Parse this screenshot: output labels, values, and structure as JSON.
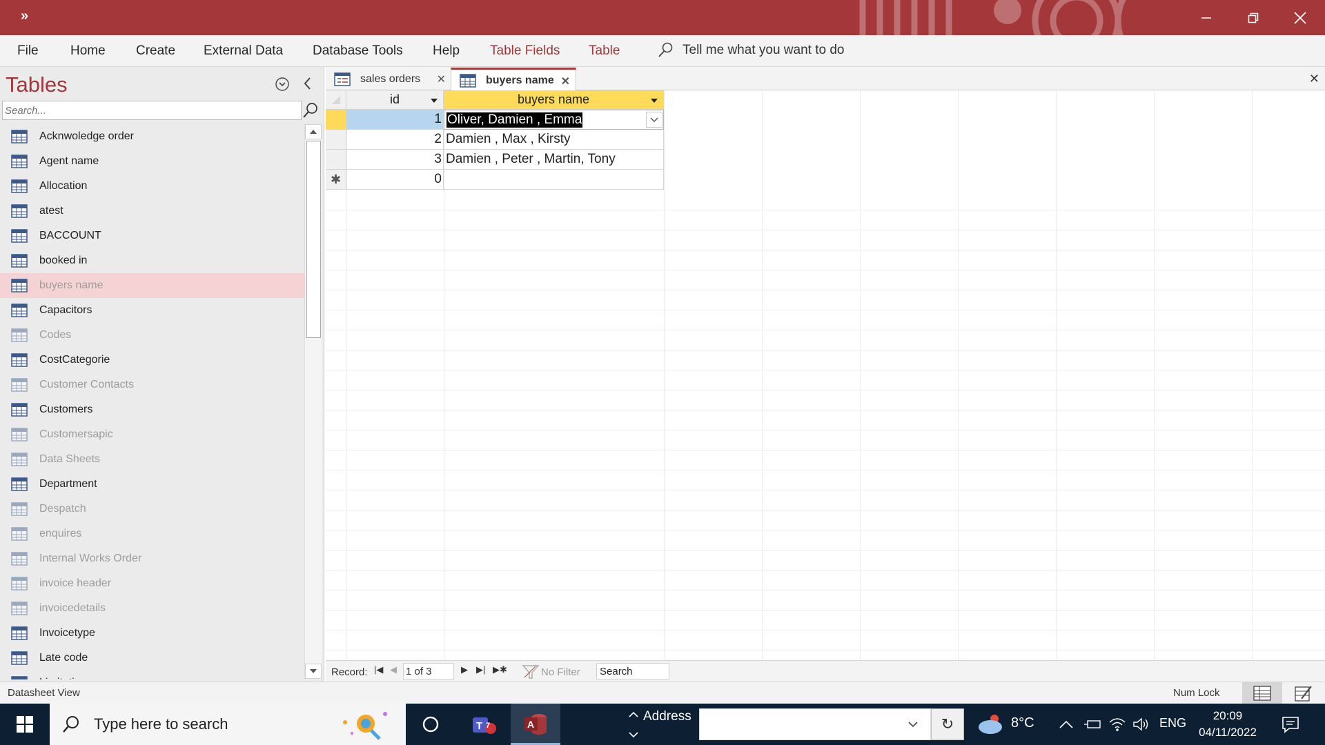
{
  "window": {
    "qat_label": "»",
    "accent_color": "#a4373a"
  },
  "menu": [
    {
      "label": "File",
      "contextual": false
    },
    {
      "label": "Home",
      "contextual": false
    },
    {
      "label": "Create",
      "contextual": false
    },
    {
      "label": "External Data",
      "contextual": false
    },
    {
      "label": "Database Tools",
      "contextual": false
    },
    {
      "label": "Help",
      "contextual": false
    },
    {
      "label": "Table Fields",
      "contextual": true
    },
    {
      "label": "Table",
      "contextual": true
    }
  ],
  "tell_me": "Tell me what you want to do",
  "nav": {
    "title": "Tables",
    "search_placeholder": "Search...",
    "items": [
      {
        "label": "Acknwoledge order",
        "state": "normal"
      },
      {
        "label": "Agent name",
        "state": "normal"
      },
      {
        "label": "Allocation",
        "state": "normal"
      },
      {
        "label": "atest",
        "state": "normal"
      },
      {
        "label": "BACCOUNT",
        "state": "normal"
      },
      {
        "label": "booked in",
        "state": "normal"
      },
      {
        "label": "buyers name",
        "state": "selected"
      },
      {
        "label": "Capacitors",
        "state": "normal"
      },
      {
        "label": "Codes",
        "state": "dim"
      },
      {
        "label": "CostCategorie",
        "state": "normal"
      },
      {
        "label": "Customer Contacts",
        "state": "dim"
      },
      {
        "label": "Customers",
        "state": "normal"
      },
      {
        "label": "Customersapic",
        "state": "dim"
      },
      {
        "label": "Data Sheets",
        "state": "dim"
      },
      {
        "label": "Department",
        "state": "normal"
      },
      {
        "label": "Despatch",
        "state": "dim"
      },
      {
        "label": "enquires",
        "state": "dim"
      },
      {
        "label": "Internal Works Order",
        "state": "dim"
      },
      {
        "label": "invoice header",
        "state": "dim"
      },
      {
        "label": "invoicedetails",
        "state": "dim"
      },
      {
        "label": "Invoicetype",
        "state": "normal"
      },
      {
        "label": "Late code",
        "state": "normal"
      },
      {
        "label": "Limitations",
        "state": "normal"
      }
    ]
  },
  "tabs": [
    {
      "label": "sales orders",
      "icon": "form-icon",
      "active": false
    },
    {
      "label": "buyers name",
      "icon": "table-icon",
      "active": true
    }
  ],
  "grid": {
    "columns": [
      "id",
      "buyers name"
    ],
    "rows": [
      {
        "id": "1",
        "buyers_name": "Oliver, Damien , Emma",
        "current": true
      },
      {
        "id": "2",
        "buyers_name": "Damien , Max , Kirsty",
        "current": false
      },
      {
        "id": "3",
        "buyers_name": "Damien , Peter , Martin, Tony",
        "current": false
      }
    ],
    "new_row": {
      "marker": "✱",
      "id": "0"
    }
  },
  "record_nav": {
    "label": "Record:",
    "current": "1 of 3",
    "filter_label": "No Filter",
    "search_label": "Search"
  },
  "status": {
    "view": "Datasheet View",
    "num_lock": "Num Lock"
  },
  "taskbar": {
    "search_placeholder": "Type here to search",
    "teams_badge": "7",
    "address_label": "Address",
    "temperature": "8°C",
    "language": "ENG",
    "time": "20:09",
    "date": "04/11/2022"
  }
}
